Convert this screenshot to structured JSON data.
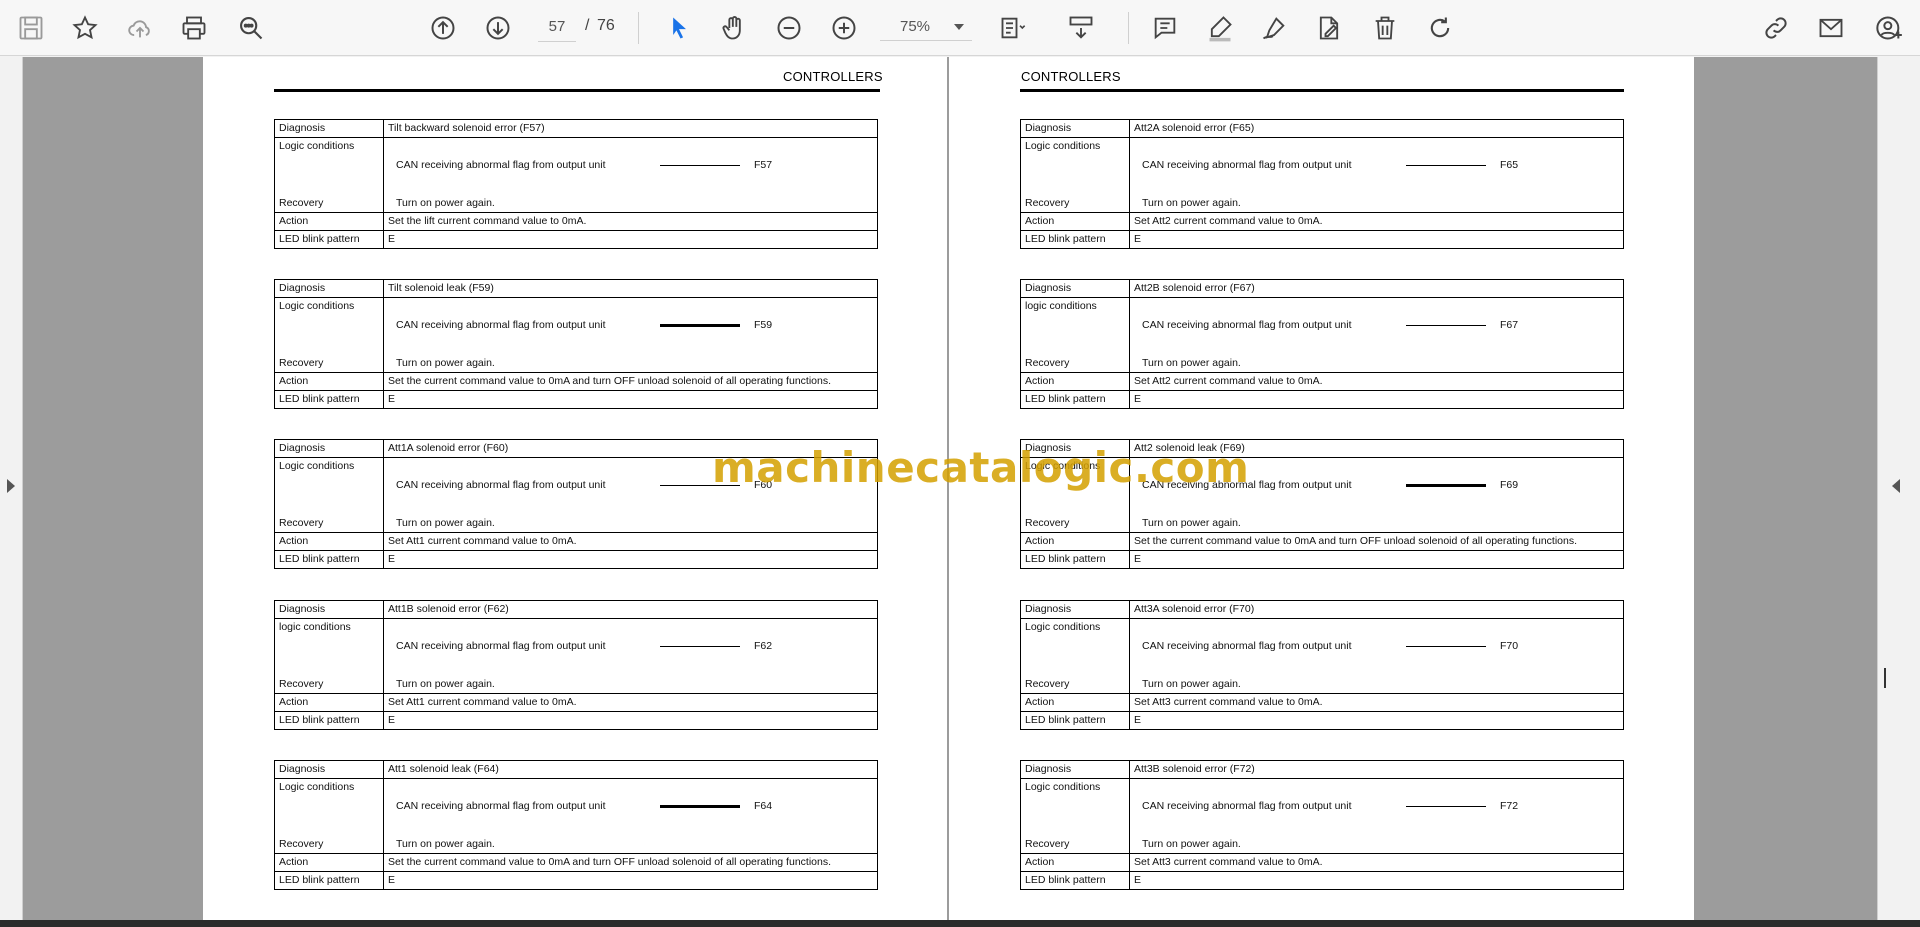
{
  "toolbar": {
    "page_current": "57",
    "page_separator": "/",
    "page_total": "76",
    "zoom": "75%",
    "left_icons": [
      "save-icon",
      "bookmark-star-icon",
      "cloud-upload-icon",
      "print-icon",
      "zoom-search-icon"
    ],
    "nav_icons": [
      "page-up-icon",
      "page-down-icon"
    ],
    "tool_icons": [
      "select-cursor-icon",
      "hand-pan-icon",
      "zoom-out-icon",
      "zoom-in-icon"
    ],
    "edit_icons": [
      "fit-page-icon",
      "scroll-mode-icon",
      "comment-icon",
      "highlight-pen-icon",
      "draw-sign-icon",
      "edit-pdf-icon",
      "delete-icon",
      "rotate-icon"
    ],
    "right_icons": [
      "share-link-icon",
      "email-icon",
      "account-add-icon"
    ],
    "accent": "#1a73e8"
  },
  "watermark": "machinecatalogic.com",
  "pages": [
    {
      "header": "CONTROLLERS",
      "tables": [
        {
          "diagnosis_label": "Diagnosis",
          "diagnosis": "Tilt backward solenoid error (F57)",
          "logic_label": "Logic conditions",
          "can": "CAN receiving abnormal flag from output unit",
          "code": "F57",
          "thick": false,
          "recovery_label": "Recovery",
          "recovery": "Turn on power again.",
          "action_label": "Action",
          "action": "Set the lift current command value to 0mA.",
          "led_label": "LED blink pattern",
          "led": "E"
        },
        {
          "diagnosis_label": "Diagnosis",
          "diagnosis": "Tilt solenoid leak (F59)",
          "logic_label": "Logic conditions",
          "can": "CAN receiving abnormal flag from output unit",
          "code": "F59",
          "thick": true,
          "recovery_label": "Recovery",
          "recovery": "Turn on power again.",
          "action_label": "Action",
          "action": "Set the current command value to 0mA and turn OFF unload solenoid of all operating functions.",
          "led_label": "LED blink pattern",
          "led": "E"
        },
        {
          "diagnosis_label": "Diagnosis",
          "diagnosis": "Att1A solenoid error (F60)",
          "logic_label": "Logic conditions",
          "can": "CAN receiving abnormal flag from output unit",
          "code": "F60",
          "thick": false,
          "recovery_label": "Recovery",
          "recovery": "Turn on power again.",
          "action_label": "Action",
          "action": "Set Att1 current command value to 0mA.",
          "led_label": "LED blink pattern",
          "led": "E"
        },
        {
          "diagnosis_label": "Diagnosis",
          "diagnosis": "Att1B solenoid error (F62)",
          "logic_label": "logic conditions",
          "can": "CAN receiving abnormal flag from output unit",
          "code": "F62",
          "thick": false,
          "recovery_label": "Recovery",
          "recovery": "Turn on power again.",
          "action_label": "Action",
          "action": "Set Att1 current command value to 0mA.",
          "led_label": "LED blink pattern",
          "led": "E"
        },
        {
          "diagnosis_label": "Diagnosis",
          "diagnosis": "Att1 solenoid leak (F64)",
          "logic_label": "Logic conditions",
          "can": "CAN receiving abnormal flag from output unit",
          "code": "F64",
          "thick": true,
          "recovery_label": "Recovery",
          "recovery": "Turn on power again.",
          "action_label": "Action",
          "action": "Set the current command value to 0mA and turn OFF unload solenoid of all operating functions.",
          "led_label": "LED blink pattern",
          "led": "E"
        }
      ]
    },
    {
      "header": "CONTROLLERS",
      "tables": [
        {
          "diagnosis_label": "Diagnosis",
          "diagnosis": "Att2A solenoid error (F65)",
          "logic_label": "Logic conditions",
          "can": "CAN receiving abnormal flag from output unit",
          "code": "F65",
          "thick": false,
          "recovery_label": "Recovery",
          "recovery": "Turn on power again.",
          "action_label": "Action",
          "action": "Set Att2 current command value to 0mA.",
          "led_label": "LED blink pattern",
          "led": "E"
        },
        {
          "diagnosis_label": "Diagnosis",
          "diagnosis": "Att2B solenoid error (F67)",
          "logic_label": "logic conditions",
          "can": "CAN receiving abnormal flag from output unit",
          "code": "F67",
          "thick": false,
          "recovery_label": "Recovery",
          "recovery": "Turn on power again.",
          "action_label": "Action",
          "action": "Set Att2 current command value to 0mA.",
          "led_label": "LED blink pattern",
          "led": "E"
        },
        {
          "diagnosis_label": "Diagnosis",
          "diagnosis": "Att2 solenoid leak (F69)",
          "logic_label": "Logic conditions",
          "can": "CAN receiving abnormal flag from output unit",
          "code": "F69",
          "thick": true,
          "recovery_label": "Recovery",
          "recovery": "Turn on power again.",
          "action_label": "Action",
          "action": "Set the current command value to 0mA and turn OFF unload solenoid of all operating functions.",
          "led_label": "LED blink pattern",
          "led": "E"
        },
        {
          "diagnosis_label": "Diagnosis",
          "diagnosis": "Att3A solenoid error (F70)",
          "logic_label": "Logic conditions",
          "can": "CAN receiving abnormal flag from output unit",
          "code": "F70",
          "thick": false,
          "recovery_label": "Recovery",
          "recovery": "Turn on power again.",
          "action_label": "Action",
          "action": "Set Att3 current command value to 0mA.",
          "led_label": "LED blink pattern",
          "led": "E"
        },
        {
          "diagnosis_label": "Diagnosis",
          "diagnosis": "Att3B solenoid error (F72)",
          "logic_label": "Logic conditions",
          "can": "CAN receiving abnormal flag from output unit",
          "code": "F72",
          "thick": false,
          "recovery_label": "Recovery",
          "recovery": "Turn on power again.",
          "action_label": "Action",
          "action": "Set Att3 current command value to 0mA.",
          "led_label": "LED blink pattern",
          "led": "E"
        }
      ]
    }
  ]
}
